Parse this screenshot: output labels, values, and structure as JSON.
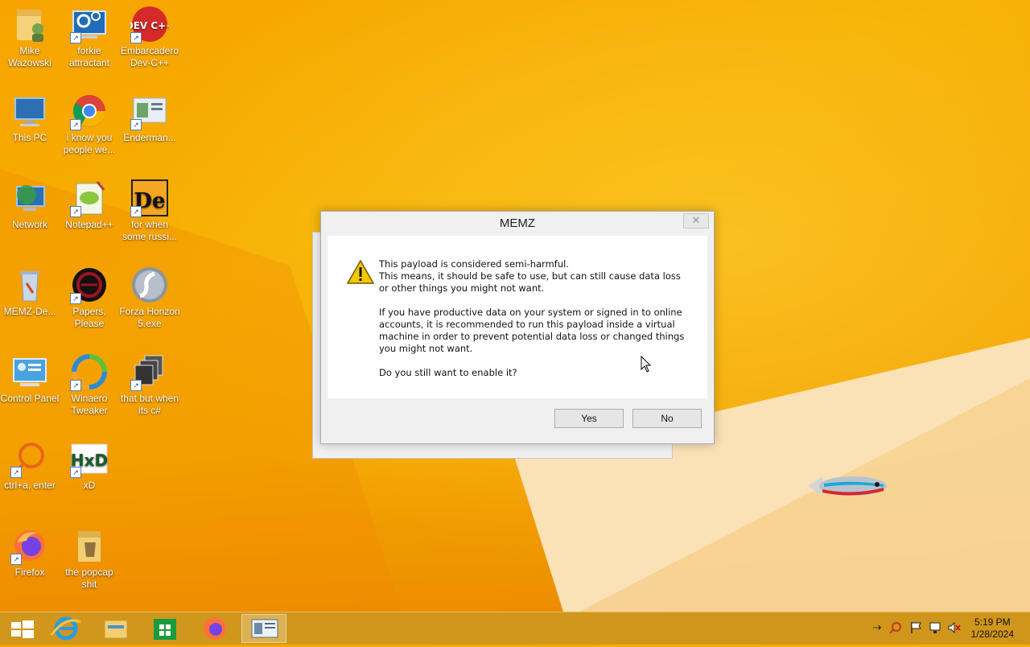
{
  "desktop": {
    "icons": [
      {
        "label": "Mike Wazowski"
      },
      {
        "label": "forkie attractant"
      },
      {
        "label": "Embarcadero Dev-C++"
      },
      {
        "label": "This PC"
      },
      {
        "label": "i know you people we..."
      },
      {
        "label": "Enderman..."
      },
      {
        "label": "Network"
      },
      {
        "label": "Notepad++"
      },
      {
        "label": "for when some russi..."
      },
      {
        "label": "MEMZ-De..."
      },
      {
        "label": "Papers, Please"
      },
      {
        "label": "Forza Horizon 5.exe"
      },
      {
        "label": "Control Panel"
      },
      {
        "label": "Winaero Tweaker"
      },
      {
        "label": "that but when its c#"
      },
      {
        "label": "ctrl+a, enter"
      },
      {
        "label": "xD"
      },
      {
        "label": "Firefox"
      },
      {
        "label": "the popcap shit"
      }
    ],
    "icon_texts": {
      "devcpp": "DEV C++",
      "hxd": "HxD",
      "de": "De"
    }
  },
  "dialog": {
    "title": "MEMZ",
    "close_glyph": "✕",
    "line1": "This payload is considered semi-harmful.",
    "line2": "This means, it should be safe to use, but can still cause data loss or other things you might not want.",
    "para2": "If you have productive data on your system or signed in to online accounts, it is recommended to run this payload inside a virtual machine in order to prevent potential data loss or changed things you might not want.",
    "question": "Do you still want to enable it?",
    "yes_label": "Yes",
    "no_label": "No"
  },
  "taskbar": {
    "clock_time": "5:19 PM",
    "clock_date": "1/28/2024"
  },
  "colors": {
    "accent": "#f6a800",
    "taskbar": "#cd961e",
    "dialog_bg": "#f0f0f0"
  }
}
